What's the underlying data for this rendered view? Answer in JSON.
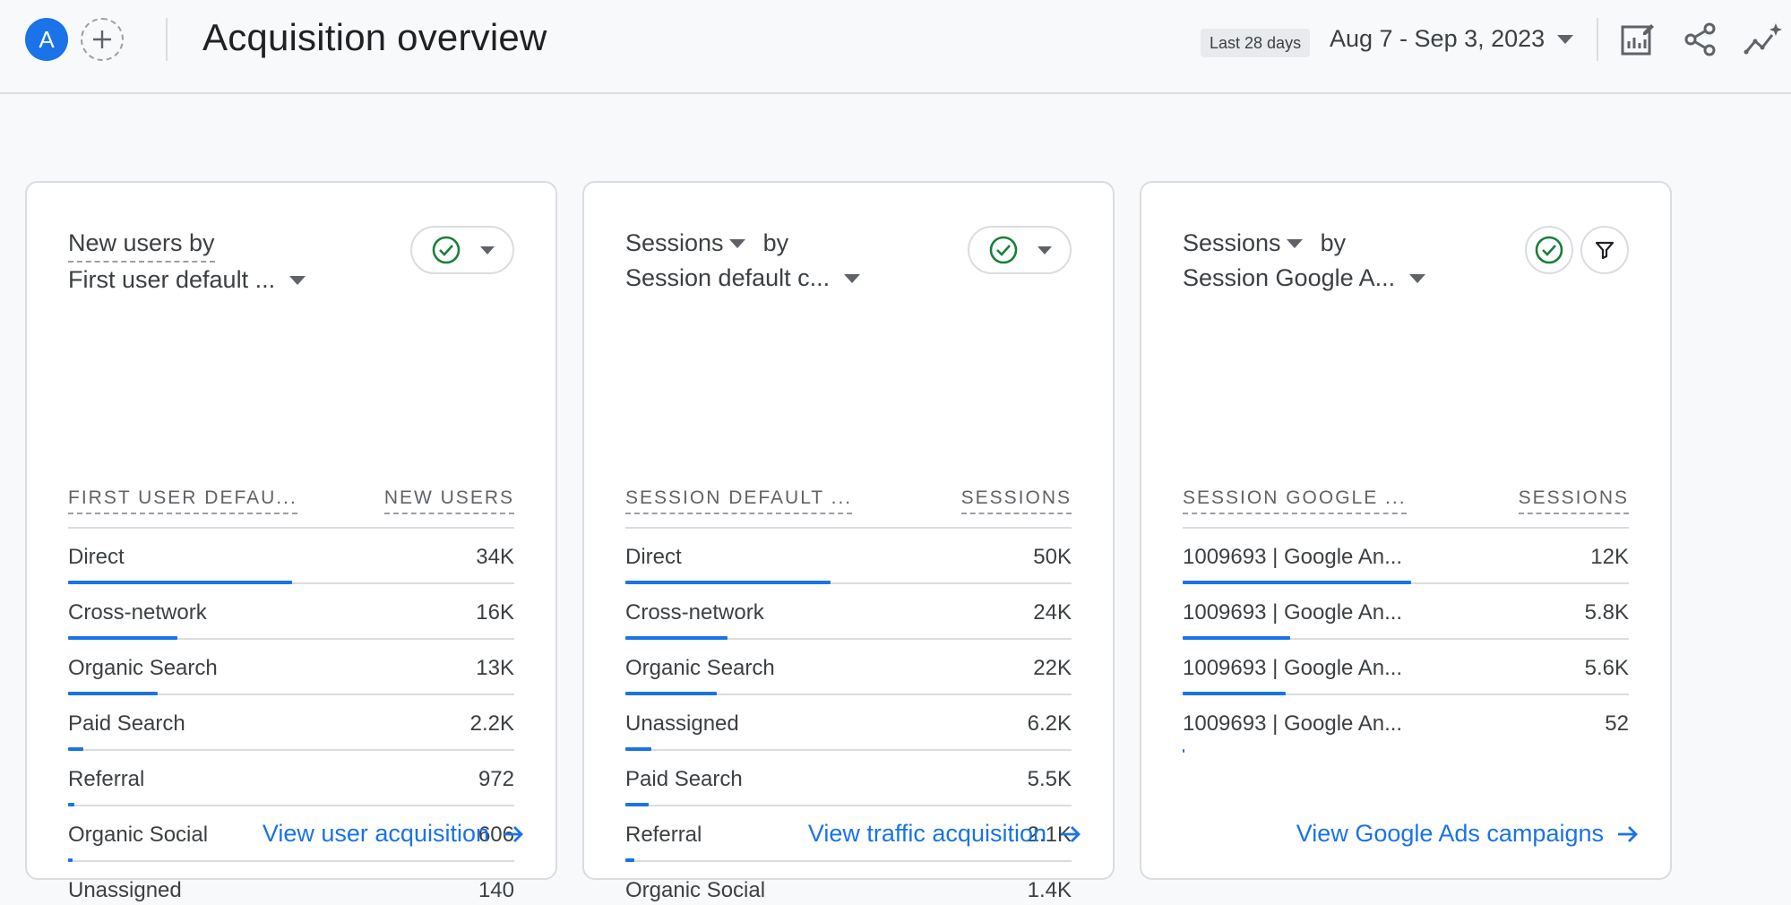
{
  "header": {
    "avatar_letter": "A",
    "title": "Acquisition overview",
    "date_chip": "Last 28 days",
    "date_range": "Aug 7 - Sep 3, 2023"
  },
  "colors": {
    "accent": "#1a73e8",
    "check": "#188038",
    "border": "#dadce0"
  },
  "cards": [
    {
      "title_line1": "New users by",
      "title_line2": "First user default ...",
      "col1": "FIRST USER DEFAU...",
      "col2": "NEW USERS",
      "link": "View user acquisition",
      "rows": [
        {
          "label": "Direct",
          "value": "34K",
          "share": 0.503
        },
        {
          "label": "Cross-network",
          "value": "16K",
          "share": 0.245
        },
        {
          "label": "Organic Search",
          "value": "13K",
          "share": 0.2
        },
        {
          "label": "Paid Search",
          "value": "2.2K",
          "share": 0.035
        },
        {
          "label": "Referral",
          "value": "972",
          "share": 0.015
        },
        {
          "label": "Organic Social",
          "value": "606",
          "share": 0.01
        },
        {
          "label": "Unassigned",
          "value": "140",
          "share": 0.003
        }
      ]
    },
    {
      "title_line1": "Sessions",
      "title_by": "by",
      "title_line2": "Session default c...",
      "col1": "SESSION DEFAULT ...",
      "col2": "SESSIONS",
      "link": "View traffic acquisition",
      "rows": [
        {
          "label": "Direct",
          "value": "50K",
          "share": 0.46
        },
        {
          "label": "Cross-network",
          "value": "24K",
          "share": 0.228
        },
        {
          "label": "Organic Search",
          "value": "22K",
          "share": 0.205
        },
        {
          "label": "Unassigned",
          "value": "6.2K",
          "share": 0.058
        },
        {
          "label": "Paid Search",
          "value": "5.5K",
          "share": 0.052
        },
        {
          "label": "Referral",
          "value": "2.1K",
          "share": 0.02
        },
        {
          "label": "Organic Social",
          "value": "1.4K",
          "share": 0.013
        }
      ]
    },
    {
      "title_line1": "Sessions",
      "title_by": "by",
      "title_line2": "Session Google A...",
      "col1": "SESSION GOOGLE ...",
      "col2": "SESSIONS",
      "link": "View Google Ads campaigns",
      "rows": [
        {
          "label": "1009693 | Google An...",
          "value": "12K",
          "share": 0.513
        },
        {
          "label": "1009693 | Google An...",
          "value": "5.8K",
          "share": 0.24
        },
        {
          "label": "1009693 | Google An...",
          "value": "5.6K",
          "share": 0.23
        },
        {
          "label": "1009693 | Google An...",
          "value": "52",
          "share": 0.003
        }
      ]
    }
  ]
}
